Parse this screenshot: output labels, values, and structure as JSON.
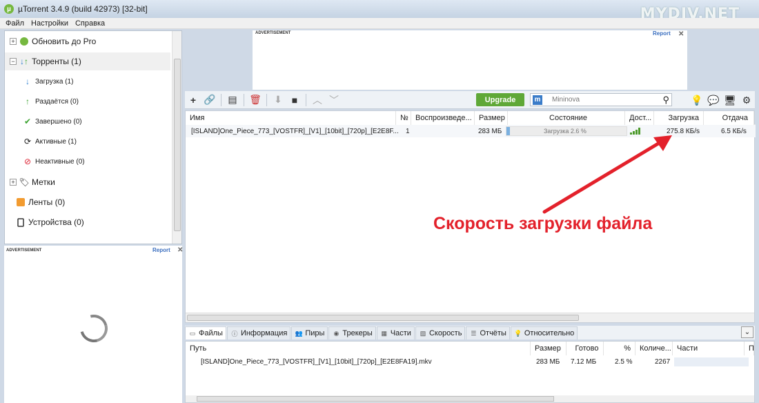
{
  "window": {
    "title": "µTorrent 3.4.9  (build 42973) [32-bit]",
    "watermark": "MYDIV.NET"
  },
  "menu": [
    "Файл",
    "Настройки",
    "Справка"
  ],
  "sidebar": {
    "items": [
      {
        "label": "Обновить до Pro",
        "icon": "utorrent-logo-icon"
      },
      {
        "label": "Торренты (1)",
        "icon": "torrents-arrows-icon"
      },
      {
        "label": "Загрузка (1)",
        "icon": "download-arrow-icon"
      },
      {
        "label": "Раздаётся (0)",
        "icon": "upload-arrow-icon"
      },
      {
        "label": "Завершено (0)",
        "icon": "checkmark-icon"
      },
      {
        "label": "Активные (1)",
        "icon": "refresh-icon"
      },
      {
        "label": "Неактивные (0)",
        "icon": "inactive-icon"
      },
      {
        "label": "Метки",
        "icon": "tag-icon"
      },
      {
        "label": "Ленты (0)",
        "icon": "rss-icon"
      },
      {
        "label": "Устройства (0)",
        "icon": "device-icon"
      }
    ]
  },
  "ads": {
    "label": "ADVERTISEMENT",
    "report": "Report",
    "close": "✕"
  },
  "toolbar": {
    "upgrade": "Upgrade",
    "search_placeholder": "Mininova",
    "search_engine": "m"
  },
  "torrents": {
    "columns": [
      "Имя",
      "№",
      "Воспроизведе...",
      "Размер",
      "Состояние",
      "Дост...",
      "Загрузка",
      "Отдача"
    ],
    "rows": [
      {
        "name": "[ISLAND]One_Piece_773_[VOSTFR]_[V1]_[10bit]_[720p]_[E2E8F...",
        "num": "1",
        "size": "283 МБ",
        "status": "Загрузка 2.6 %",
        "progress": 0.026,
        "download": "275.8 КБ/s",
        "upload": "6.5 КБ/s"
      }
    ]
  },
  "annotation": "Скорость загрузки файла",
  "tabs": [
    "Файлы",
    "Информация",
    "Пиры",
    "Трекеры",
    "Части",
    "Скорость",
    "Отчёты",
    "Относительно"
  ],
  "files": {
    "columns": [
      "Путь",
      "Размер",
      "Готово",
      "%",
      "Количе...",
      "Части",
      "П"
    ],
    "rows": [
      {
        "path": "[ISLAND]One_Piece_773_[VOSTFR]_[V1]_[10bit]_[720p]_[E2E8FA19].mkv",
        "size": "283 МБ",
        "done": "7.12 МБ",
        "percent": "2.5 %",
        "count": "2267"
      }
    ]
  },
  "colors": {
    "accent": "#5fa837",
    "annotation": "#e3212b",
    "progress": "#7ab0e0"
  }
}
